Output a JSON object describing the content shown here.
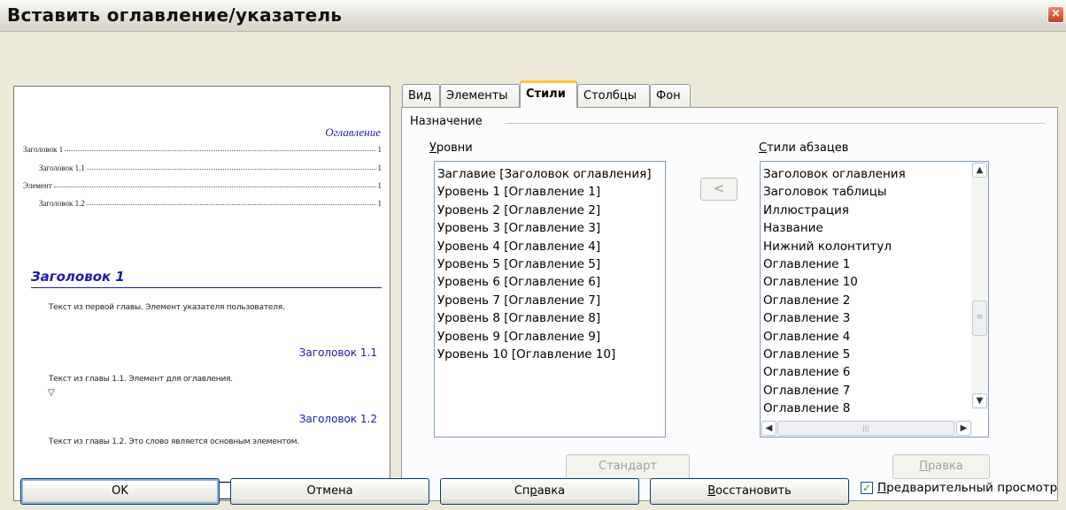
{
  "window": {
    "title": "Вставить оглавление/указатель",
    "close_glyph": "×"
  },
  "preview": {
    "toc_title": "Оглавление",
    "toc_entries": [
      {
        "text": "Заголовок 1",
        "page": "1"
      },
      {
        "text": "Заголовок 1.1",
        "page": "1"
      },
      {
        "text": "Элемент",
        "page": "1"
      },
      {
        "text": "Заголовок 1.2",
        "page": "1"
      }
    ],
    "heading1": "Заголовок 1",
    "text1": "Текст из первой главы. Элемент указателя пользователя.",
    "heading11": "Заголовок 1.1",
    "text11": "Текст из главы 1.1. Элемент для оглавления.",
    "heading12": "Заголовок 1.2",
    "text12": "Текст из главы 1.2. Это слово является основным элементом."
  },
  "tabs": [
    "Вид",
    "Элементы",
    "Стили",
    "Столбцы",
    "Фон"
  ],
  "active_tab": "Стили",
  "assignment": {
    "group_label": "Назначение",
    "levels_label_first": "У",
    "levels_label_rest": "ровни",
    "styles_label_first": "С",
    "styles_label_rest": "тили абзацев",
    "move_button": "<",
    "levels": [
      "Заглавие [Заголовок оглавления]",
      "Уровень 1 [Оглавление 1]",
      "Уровень 2 [Оглавление 2]",
      "Уровень 3 [Оглавление 3]",
      "Уровень 4 [Оглавление 4]",
      "Уровень 5 [Оглавление 5]",
      "Уровень 6 [Оглавление 6]",
      "Уровень 7 [Оглавление 7]",
      "Уровень 8 [Оглавление 8]",
      "Уровень 9 [Оглавление 9]",
      "Уровень 10 [Оглавление 10]"
    ],
    "styles": [
      "Заголовок оглавления",
      "Заголовок таблицы",
      "Иллюстрация",
      "Название",
      "Нижний колонтитул",
      "Оглавление 1",
      "Оглавление 10",
      "Оглавление 2",
      "Оглавление 3",
      "Оглавление 4",
      "Оглавление 5",
      "Оглавление 6",
      "Оглавление 7",
      "Оглавление 8"
    ],
    "default_button": "Стандарт",
    "edit_button_first": "П",
    "edit_button_rest": "равка"
  },
  "buttons": {
    "ok": "OK",
    "cancel": "Отмена",
    "help_a": "Сп",
    "help_u": "р",
    "help_b": "авка",
    "reset_first": "В",
    "reset_rest": "осстановить"
  },
  "preview_checkbox": {
    "label_first": "П",
    "label_rest": "редварительный просмотр",
    "checked": true
  }
}
